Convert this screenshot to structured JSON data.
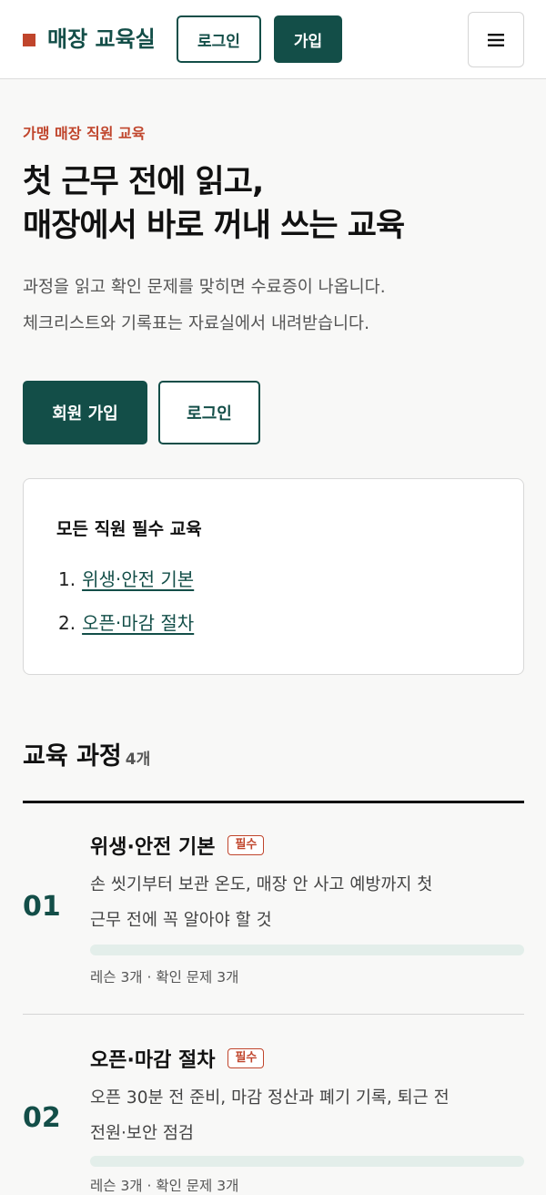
{
  "header": {
    "brand": "매장 교육실",
    "login_label": "로그인",
    "join_label": "가입",
    "menu_icon": "hamburger-menu-icon"
  },
  "hero": {
    "eyebrow": "가맹 매장 직원 교육",
    "title_lines": [
      "첫 근무 전에 읽고,",
      "매장에서 바로 꺼내 쓰는 교육"
    ],
    "desc_lines": [
      "과정을 읽고 확인 문제를 맞히면 수료증이 나옵니다.",
      "체크리스트와 기록표는 자료실에서 내려받습니다."
    ],
    "join_label": "회원 가입",
    "login_label": "로그인"
  },
  "required": {
    "title": "모든 직원 필수 교육",
    "items": [
      {
        "num": "1.",
        "label": "위생·안전 기본"
      },
      {
        "num": "2.",
        "label": "오픈·마감 절차"
      }
    ]
  },
  "courses": {
    "title": "교육 과정",
    "count": "4개",
    "items": [
      {
        "num": "01",
        "title": "위생·안전 기본",
        "badge": "필수",
        "desc_lines": [
          "손 씻기부터 보관 온도, 매장 안 사고 예방까지 첫",
          "근무 전에 꼭 알아야 할 것"
        ],
        "progress": 0,
        "meta": "레슨 3개 · 확인 문제 3개"
      },
      {
        "num": "02",
        "title": "오픈·마감 절차",
        "badge": "필수",
        "desc_lines": [
          "오픈 30분 전 준비, 마감 정산과 폐기 기록, 퇴근 전",
          "전원·보안 점검"
        ],
        "progress": 0,
        "meta": "레슨 3개 · 확인 문제 3개"
      }
    ]
  },
  "colors": {
    "brand": "#134e48",
    "accent": "#c0452c",
    "background": "#f8f8f7"
  }
}
